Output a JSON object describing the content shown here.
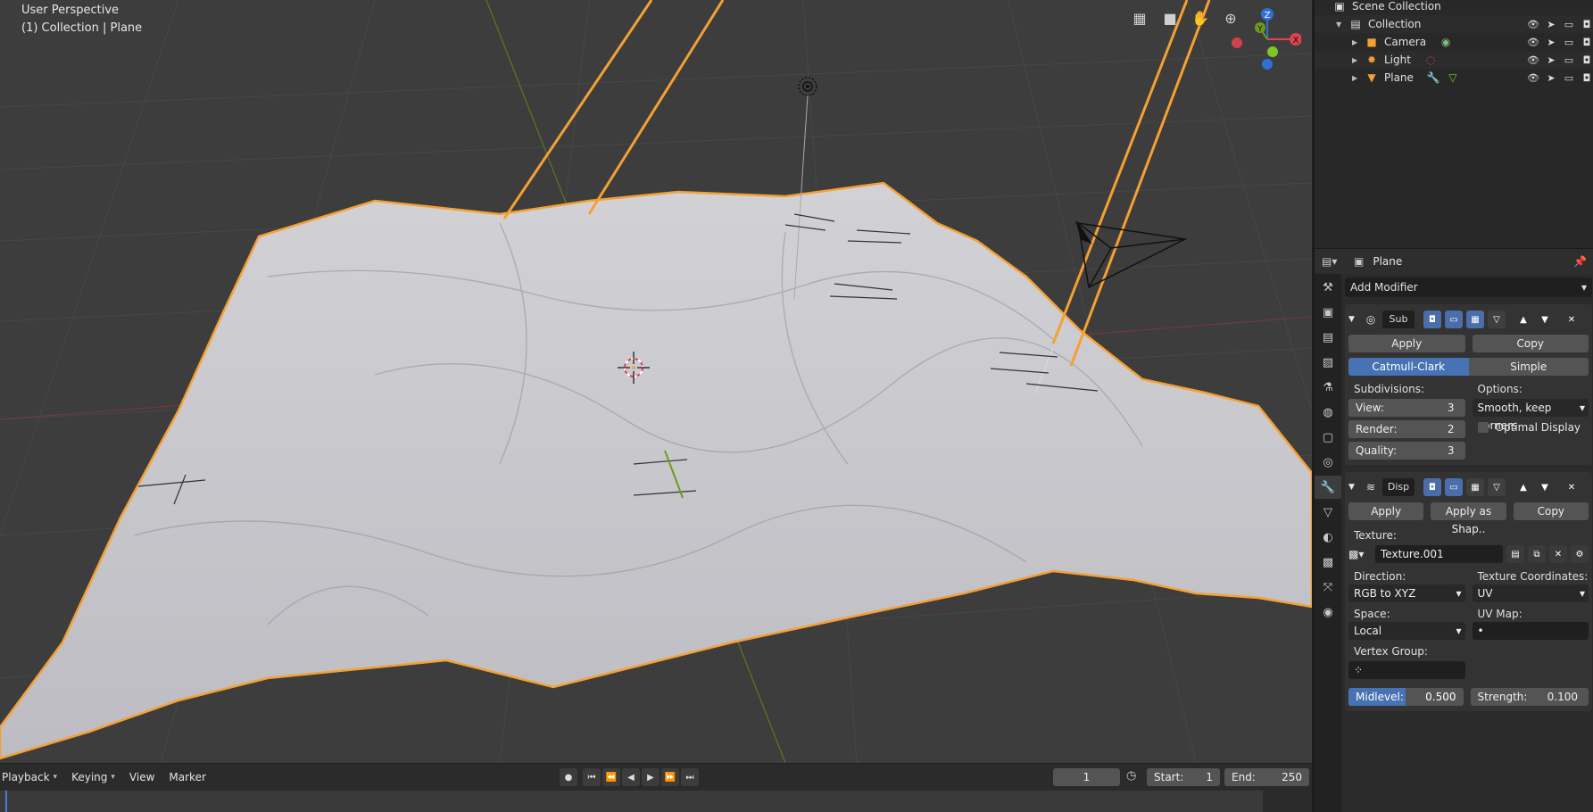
{
  "viewport": {
    "perspective_label": "User Perspective",
    "context_label": "(1) Collection | Plane",
    "tools": [
      "grid-icon",
      "camera-view-icon",
      "hand-pan-icon",
      "zoom-icon"
    ],
    "gizmo": {
      "x_label": "X",
      "y_label": "Y",
      "z_label": "Z"
    }
  },
  "timeline": {
    "menu": [
      {
        "label": "Playback",
        "has_dropdown": true
      },
      {
        "label": "Keying",
        "has_dropdown": true
      },
      {
        "label": "View",
        "has_dropdown": false
      },
      {
        "label": "Marker",
        "has_dropdown": false
      }
    ],
    "current_frame": "1",
    "start_label": "Start:",
    "start_value": "1",
    "end_label": "End:",
    "end_value": "250"
  },
  "outliner": {
    "root": "Scene Collection",
    "collection": "Collection",
    "items": [
      {
        "name": "Camera",
        "icon": "camera-object-icon",
        "data_icon": "camera-data-icon"
      },
      {
        "name": "Light",
        "icon": "light-object-icon",
        "data_icon": "light-data-icon"
      },
      {
        "name": "Plane",
        "icon": "mesh-object-icon",
        "data_icon": "modifier-wrench-icon"
      }
    ]
  },
  "properties": {
    "object_name": "Plane",
    "add_modifier": "Add Modifier",
    "subsurf": {
      "name": "Sub",
      "apply": "Apply",
      "copy": "Copy",
      "mode_selected": "Catmull-Clark",
      "mode_other": "Simple",
      "subdivisions_label": "Subdivisions:",
      "options_label": "Options:",
      "view_label": "View:",
      "view_value": "3",
      "render_label": "Render:",
      "render_value": "2",
      "quality_label": "Quality:",
      "quality_value": "3",
      "uv_smooth": "Smooth, keep corners",
      "optimal_display": "Optimal Display"
    },
    "displace": {
      "name": "Disp",
      "apply": "Apply",
      "apply_shape": "Apply as Shap..",
      "copy": "Copy",
      "texture_label": "Texture:",
      "texture_value": "Texture.001",
      "direction_label": "Direction:",
      "direction_value": "RGB to XYZ",
      "tex_coords_label": "Texture Coordinates:",
      "tex_coords_value": "UV",
      "space_label": "Space:",
      "space_value": "Local",
      "uv_map_label": "UV Map:",
      "uv_map_value": "•",
      "vertex_group_label": "Vertex Group:",
      "midlevel_label": "Midlevel:",
      "midlevel_value": "0.500",
      "midlevel_fraction": 0.5,
      "strength_label": "Strength:",
      "strength_value": "0.100"
    }
  },
  "colors": {
    "selection_orange": "#f5a033",
    "accent_blue": "#4772b3",
    "axis_red": "#e0424e",
    "axis_green": "#6f9a1a",
    "axis_blue": "#2f6fd6"
  }
}
